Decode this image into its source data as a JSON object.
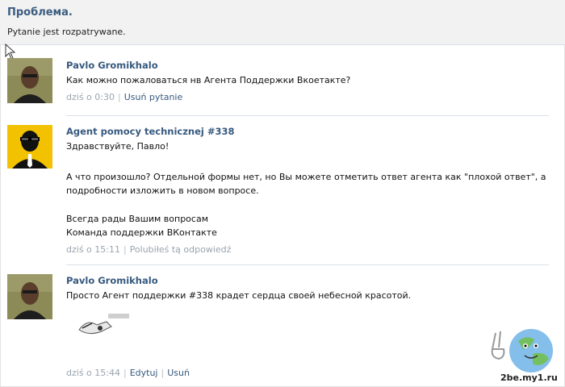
{
  "problem": {
    "title": "Проблема.",
    "status": "Pytanie jest rozpatrywane."
  },
  "messages": [
    {
      "author": "Pavlo Gromikhalo",
      "lines": [
        "Как можно пожаловаться нв Агента Поддержки Вкоетакте?"
      ],
      "time": "dziś o 0:30",
      "actions": [
        "Usuń pytanie"
      ]
    },
    {
      "author": "Agent pomocy technicznej #338",
      "lines": [
        "Здравствуйте, Павло!",
        "А что произошло? Отдельной формы нет, но Вы можете отметить ответ агента как \"плохой ответ\", а",
        "подробности изложить в новом вопросе.",
        "Всегда рады Вашим вопросам",
        "Команда поддержки ВКонтакте"
      ],
      "time": "dziś o 15:11",
      "actions": [
        "Polubiłeś tą odpowiedź"
      ]
    },
    {
      "author": "Pavlo Gromikhalo",
      "lines": [
        "Просто Агент поддержки #338 крадет сердца своей небесной красотой."
      ],
      "time": "dziś o 15:44",
      "actions": [
        "Edytuj",
        "Usuń"
      ]
    }
  ],
  "watermark": "2be.my1.ru",
  "colors": {
    "link": "#36597e",
    "meta": "#9aa4af",
    "divider": "#dbe1e7",
    "problem_bg": "#f2f2f2",
    "agent_avatar_bg": "#f2c200"
  },
  "icons": [
    "mouse-cursor-icon",
    "globe-peace-icon"
  ]
}
